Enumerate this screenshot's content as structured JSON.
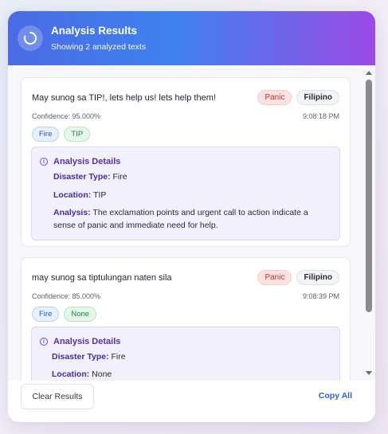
{
  "header": {
    "title": "Analysis Results",
    "subtitle": "Showing 2 analyzed texts"
  },
  "results": [
    {
      "text": "May sunog sa TIP!, lets help us! lets help them!",
      "sentiment": "Panic",
      "language": "Filipino",
      "confidence": "Confidence: 95.000%",
      "time": "9:08:18 PM",
      "tags": [
        "Fire",
        "TIP"
      ],
      "details": {
        "heading": "Analysis Details",
        "disaster_label": "Disaster Type:",
        "disaster_value": "Fire",
        "location_label": "Location:",
        "location_value": "TIP",
        "analysis_label": "Analysis:",
        "analysis_value": "The exclamation points and urgent call to action indicate a",
        "analysis_value_2": "sense of panic and immediate need for help."
      }
    },
    {
      "text": "may sunog sa tiptulungan naten sila",
      "sentiment": "Panic",
      "language": "Filipino",
      "confidence": "Confidence: 85.000%",
      "time": "9:08:39 PM",
      "tags": [
        "Fire",
        "None"
      ],
      "details": {
        "heading": "Analysis Details",
        "disaster_label": "Disaster Type:",
        "disaster_value": "Fire",
        "location_label": "Location:",
        "location_value": "None"
      }
    }
  ],
  "footer": {
    "clear_label": "Clear Results",
    "copy_label": "Copy All"
  },
  "icons": {
    "header": "loader-icon",
    "details": "info-icon"
  },
  "colors": {
    "header_start": "#4b6be4",
    "header_end": "#9a4be6",
    "panic": "#c53030",
    "accent": "#2f5fd6"
  }
}
